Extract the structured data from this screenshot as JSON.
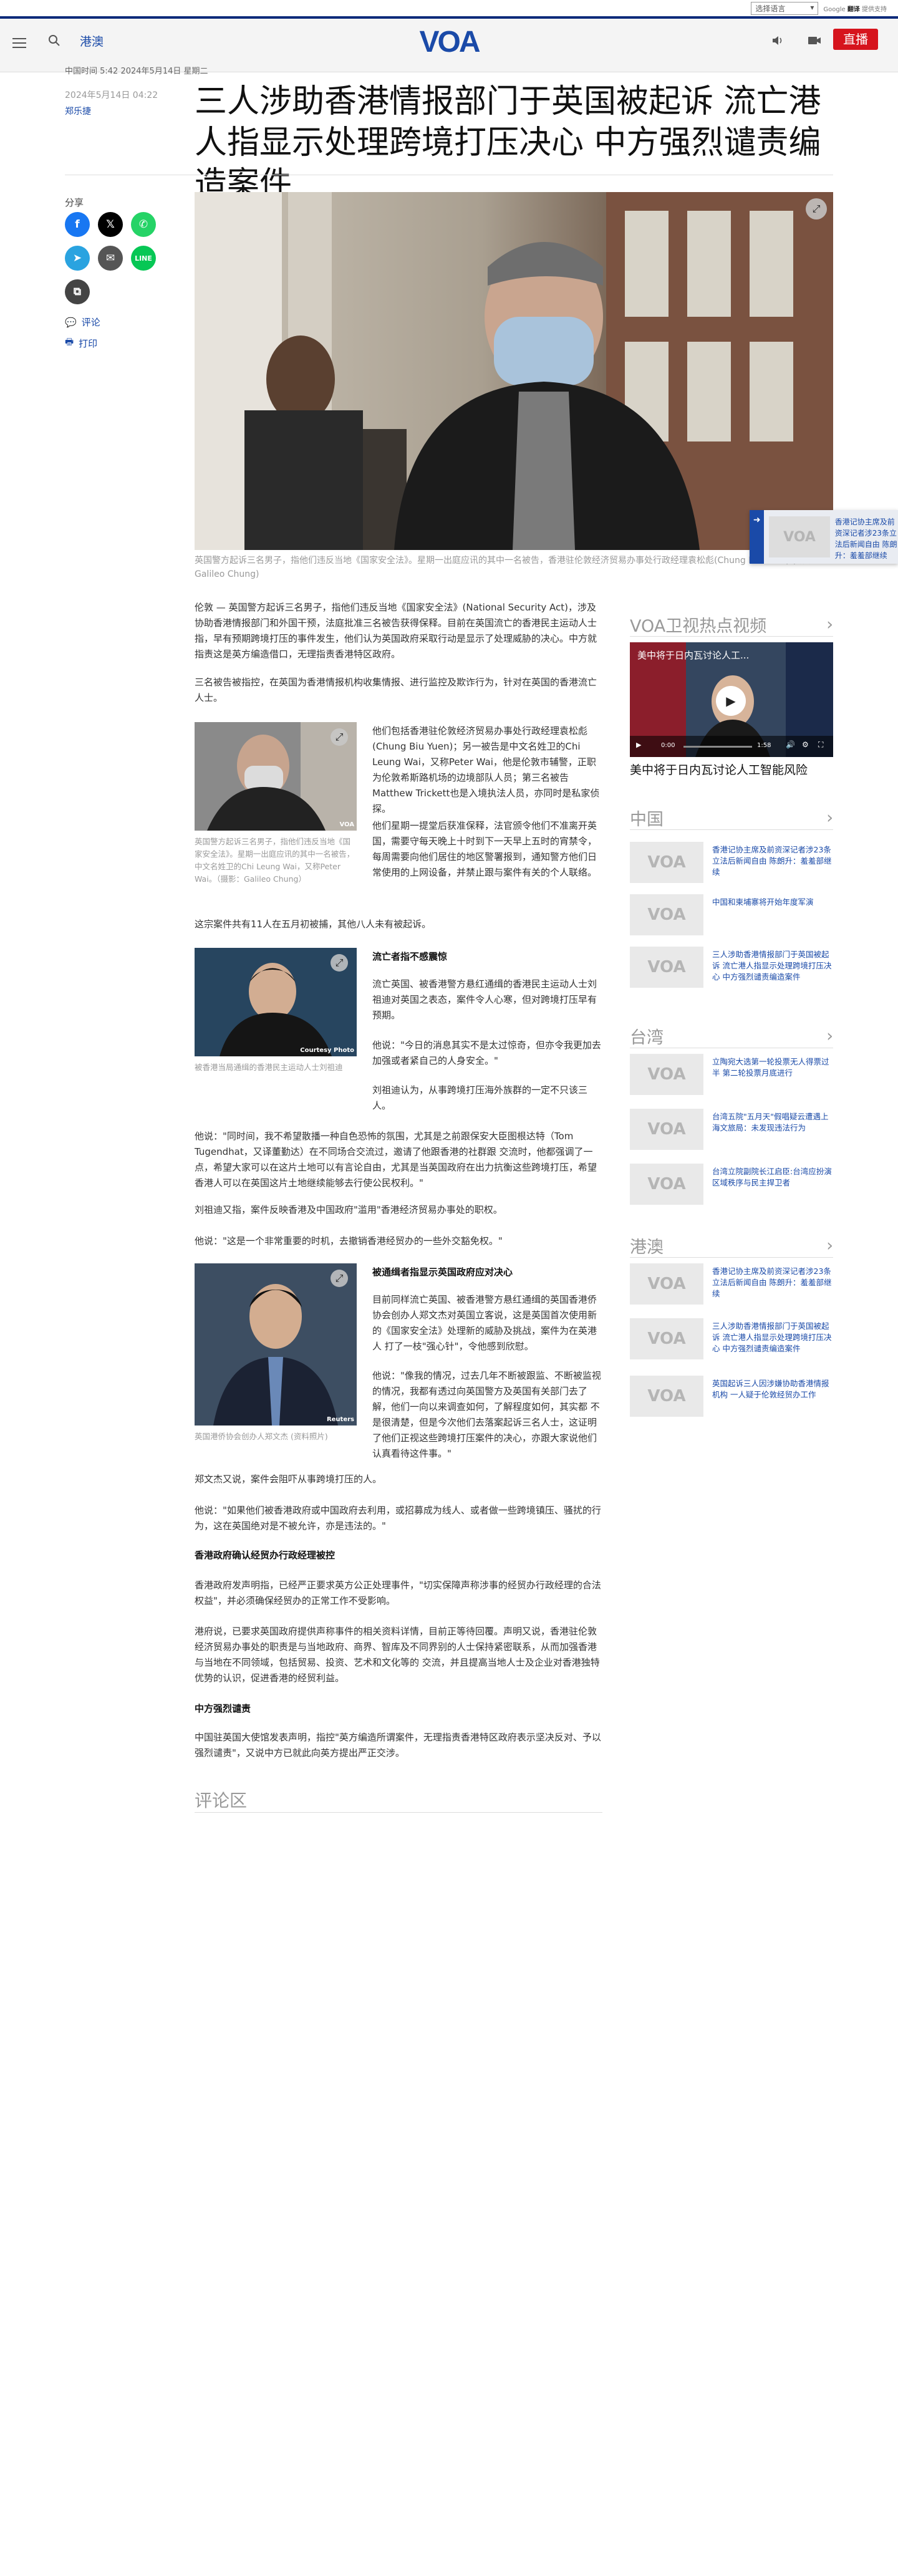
{
  "translate": {
    "select_label": "选择语言",
    "powered_by": "Google",
    "translate_word": "翻译",
    "powered_suffix": "提供支持"
  },
  "header": {
    "section": "港澳",
    "logo": "VOA",
    "live_label": "直播"
  },
  "article": {
    "published": "中国时间 5:42 2024年5月14日 星期二",
    "date_side": "2024年5月14日 04:22",
    "author": "郑乐捷",
    "headline": "三人涉助香港情报部门于英国被起诉 流亡港人指显示处理跨境打压决心 中方强烈谴责编造案件",
    "share_label": "分享",
    "comments_link": "评论",
    "print_link": "打印",
    "hero_caption": "英国警方起诉三名男子，指他们违反当地《国家安全法》。星期一出庭应讯的其中一名被告，香港驻伦敦经济贸易办事处行政经理袁松彪(Chung Biu Yuen) (摄影：Galileo Chung)",
    "paragraphs": {
      "p1": "伦敦 — 英国警方起诉三名男子，指他们违反当地《国家安全法》(National Security Act)，涉及协助香港情报部门和外国干预，法庭批准三名被告获得保释。目前在英国流亡的香港民主运动人士指，早有预期跨境打压的事件发生，他们认为英国政府采取行动是显示了处理威胁的决心。中方就指责这是英方编造借口，无理指责香港特区政府。",
      "p2": "三名被告被指控，在英国为香港情报机构收集情报、进行监控及欺诈行为，针对在英国的香港流亡人士。",
      "p3": "他们包括香港驻伦敦经济贸易办事处行政经理袁松彪(Chung Biu Yuen)；另一被告是中文名姓卫的Chi Leung Wai，又称Peter Wai，他是伦敦市辅警，正职为伦敦希斯路机场的边境部队人员；第三名被告Matthew Trickett也是入境执法人员，亦同时是私家侦探。",
      "p4": "他们星期一提堂后获准保释，法官颁令他们不准离开英国，需要守每天晚上十时到下一天早上五时的宵禁令，每周需要向他们居住的地区警署报到，通知警方他们日常使用的上网设备，并禁止跟与案件有关的个人联络。",
      "p5": "这宗案件共有11人在五月初被捕，其他八人未有被起诉。",
      "sub1": "流亡者指不感震惊",
      "p6": "流亡英国、被香港警方悬红通缉的香港民主运动人士刘祖迪对英国之表态，案件令人心寒，但对跨境打压早有预期。",
      "p7": "他说：\"今日的消息其实不是太过惊奇，但亦令我更加去加强或者紧自己的人身安全。\"",
      "p8": "刘祖迪认为，从事跨境打压海外族群的一定不只该三人。",
      "p9": "他说：\"同时间，我不希望散播一种自色恐怖的氛围，尤其是之前跟保安大臣图根达特（Tom Tugendhat，又译董勤达）在不同场合交流过，邀请了他跟香港的社群跟 交流时，他都强调了一点，希望大家可以在这片土地可以有言论自由，尤其是当英国政府在出力抗衡这些跨境打压，希望香港人可以在英国这片土地继续能够去行使公民权利。\"",
      "p10": "刘祖迪又指，案件反映香港及中国政府\"滥用\"香港经济贸易办事处的职权。",
      "p11": "他说：\"这是一个非常重要的时机，去撤销香港经贸办的一些外交豁免权。\"",
      "sub2": "被通缉者指显示英国政府应对决心",
      "p12": "目前同样流亡英国、被香港警方悬红通缉的英国香港侨协会创办人郑文杰对英国立客说，这是英国首次使用新的《国家安全法》处理新的威胁及挑战，案件为在英港人 打了一枝\"强心针\"，令他感到欣慰。",
      "p13": "他说：\"像我的情况，过去几年不断被跟监、不断被监视的情况，我都有透过向英国警方及英国有关部门去了解，他们一向以来调查如何，了解程度如何，其实都 不是很清楚，但是今次他们去落案起诉三名人士，这证明了他们正视这些跨境打压案件的决心，亦跟大家说他们认真看待这件事。\"",
      "p14": "郑文杰又说，案件会阻吓从事跨境打压的人。",
      "p15": "他说：\"如果他们被香港政府或中国政府去利用，或招募成为线人、或者做一些跨境镇压、骚扰的行为，这在英国绝对是不被允许，亦是违法的。\"",
      "sub3": "香港政府确认经贸办行政经理被控",
      "p16": "香港政府发声明指，已经严正要求英方公正处理事件，\"切实保障声称涉事的经贸办行政经理的合法权益\"，并必须确保经贸办的正常工作不受影响。",
      "p17": "港府说，已要求英国政府提供声称事件的相关资料详情，目前正等待回覆。声明又说，香港驻伦敦经济贸易办事处的职责是与当地政府、商界、智库及不同界别的人士保持紧密联系，从而加强香港与当地在不同领域，包括贸易、投资、艺术和文化等的 交流，并且提高当地人士及企业对香港独特优势的认识，促进香港的经贸利益。",
      "sub4": "中方强烈谴责",
      "p18": "中国驻英国大使馆发表声明，指控\"英方编造所谓案件，无理指责香港特区政府表示坚决反对、予以强烈谴责\"，又说中方已就此向英方提出严正交涉。"
    },
    "image2_caption": "英国警方起诉三名男子，指他们违反当地《国家安全法》。星期一出庭应讯的其中一名被告，中文名姓卫的Chi Leung Wai，又称Peter Wai。（摄影：Galileo Chung）",
    "image2_credit": "VOA",
    "image3_caption": "被香港当局通缉的香港民主运动人士刘祖迪",
    "image3_credit": "Courtesy Photo",
    "image4_caption": "英国港侨协会创办人郑文杰 (资料照片)",
    "image4_credit": "Reuters",
    "comments_title": "评论区"
  },
  "sidebar": {
    "video_section": "VOA卫视热点视频",
    "video_overlay_title": "美中将于日内瓦讨论人工...",
    "video_time_current": "0:00",
    "video_time_total": "1:58",
    "video_title": "美中将于日内瓦讨论人工智能风险",
    "sections": [
      {
        "title": "中国",
        "items": [
          {
            "text": "香港记协主席及前资深记者涉23条立法后新闻自由 陈朗升：羞羞部继续"
          },
          {
            "text": "中国和柬埔寨将开始年度军演"
          },
          {
            "text": "三人涉助香港情报部门于英国被起诉 流亡港人指显示处理跨境打压决心 中方强烈谴责编造案件"
          }
        ]
      },
      {
        "title": "台湾",
        "items": [
          {
            "text": "立陶宛大选第一轮投票无人得票过半 第二轮投票月底进行"
          },
          {
            "text": "台湾五院\"五月天\"假唱疑云遭遇上海文旅局：未发现违法行为"
          },
          {
            "text": "台湾立院副院长江启臣:台湾应扮演区域秩序与民主捍卫者"
          }
        ]
      },
      {
        "title": "港澳",
        "items": [
          {
            "text": "香港记协主席及前资深记者涉23条立法后新闻自由 陈朗升：羞羞部继续"
          },
          {
            "text": "三人涉助香港情报部门于英国被起诉 流亡港人指显示处理跨境打压决心 中方强烈谴责编造案件"
          },
          {
            "text": "英国起诉三人因涉嫌协助香港情报机构 一人疑于伦敦经贸办工作"
          }
        ]
      }
    ]
  },
  "floating": {
    "text": "香港记协主席及前资深记者涉23条立法后新闻自由 陈朗升：羞羞部继续"
  },
  "colors": {
    "brand_blue": "#1a4aa8",
    "live_red": "#d6141d",
    "header_bg": "#f4f4f4"
  }
}
